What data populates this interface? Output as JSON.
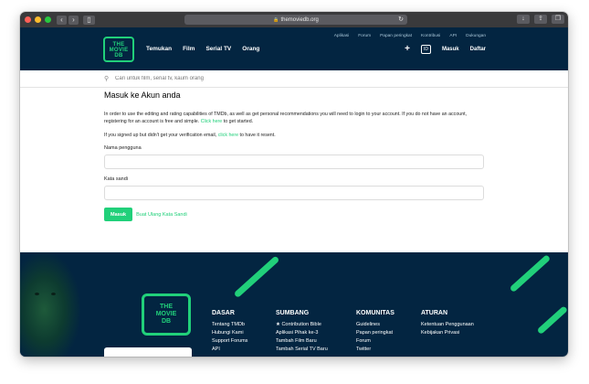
{
  "browser": {
    "url": "themoviedb.org",
    "reload_icon": "reload-icon",
    "lock_icon": "lock-icon"
  },
  "header": {
    "logo_text": "THE MOVIE DB",
    "nav": [
      "Temukan",
      "Film",
      "Serial TV",
      "Orang"
    ],
    "subnav": [
      "Aplikasi",
      "Forum",
      "Papan peringkat",
      "Kontribusi",
      "API",
      "Dukungan"
    ],
    "lang": "ID",
    "login": "Masuk",
    "signup": "Daftar"
  },
  "search": {
    "placeholder": "Cari untuk film, serial tv, kaum orang"
  },
  "login": {
    "title": "Masuk ke Akun anda",
    "para1_a": "In order to use the editing and rating capabilities of TMDb, as well as get personal recommendations you will need to login to your account. If you do not have an account, registering for an account is free and simple. ",
    "para1_link": "Click here",
    "para1_b": " to get started.",
    "para2_a": "If you signed up but didn't get your verification email, ",
    "para2_link": "click here",
    "para2_b": " to have it resent.",
    "username_label": "Nama pengguna",
    "password_label": "Kata sandi",
    "submit": "Masuk",
    "reset": "Buat Ulang Kata Sandi"
  },
  "footer": {
    "logo_text": "THE MOVIE DB",
    "columns": [
      {
        "title": "DASAR",
        "items": [
          "Tentang TMDb",
          "Hubungi Kami",
          "Support Forums",
          "API"
        ]
      },
      {
        "title": "SUMBANG",
        "items": [
          "★ Contribution Bible",
          "Aplikasi Pihak ke-3",
          "Tambah Film Baru",
          "Tambah Serial TV Baru"
        ]
      },
      {
        "title": "KOMUNITAS",
        "items": [
          "Guidelines",
          "Papan peringkat",
          "Forum",
          "Twitter"
        ]
      },
      {
        "title": "ATURAN",
        "items": [
          "Ketentuan Penggunaan",
          "Kebijakan Privasi"
        ]
      }
    ]
  },
  "colors": {
    "navy": "#032541",
    "green": "#21d07a"
  }
}
